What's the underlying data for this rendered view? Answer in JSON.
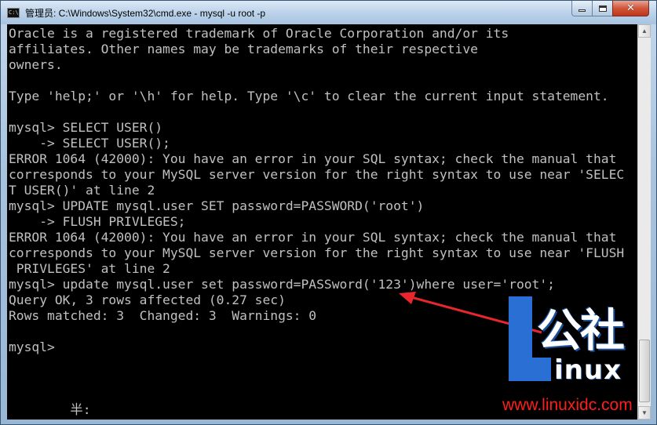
{
  "window": {
    "title": "管理员: C:\\Windows\\System32\\cmd.exe - mysql  -u root -p",
    "icon_glyph": "C:\\",
    "controls": {
      "minimize_icon": "minimize-icon",
      "maximize_icon": "maximize-icon",
      "close_icon": "close-icon",
      "close_glyph": "✕"
    }
  },
  "console": {
    "lines": [
      "Oracle is a registered trademark of Oracle Corporation and/or its",
      "affiliates. Other names may be trademarks of their respective",
      "owners.",
      "",
      "Type 'help;' or '\\h' for help. Type '\\c' to clear the current input statement.",
      "",
      "mysql> SELECT USER()",
      "    -> SELECT USER();",
      "ERROR 1064 (42000): You have an error in your SQL syntax; check the manual that",
      "corresponds to your MySQL server version for the right syntax to use near 'SELEC",
      "T USER()' at line 2",
      "mysql> UPDATE mysql.user SET password=PASSWORD('root')",
      "    -> FLUSH PRIVLEGES;",
      "ERROR 1064 (42000): You have an error in your SQL syntax; check the manual that",
      "corresponds to your MySQL server version for the right syntax to use near 'FLUSH",
      " PRIVLEGES' at line 2",
      "mysql> update mysql.user set password=PASSword('123')where user='root';",
      "Query OK, 3 rows affected (0.27 sec)",
      "Rows matched: 3  Changed: 3  Warnings: 0",
      "",
      "mysql>",
      "",
      "",
      "",
      "        半:"
    ],
    "text_color": "#c0c0c0",
    "background": "#000000"
  },
  "annotation": {
    "arrow_color": "#e8262c"
  },
  "watermark": {
    "brand_cn": "公社",
    "brand_en": "inux",
    "url": "www.linuxidc.com",
    "brand_color": "#2a6fd3",
    "url_color": "#ff1e1e"
  }
}
